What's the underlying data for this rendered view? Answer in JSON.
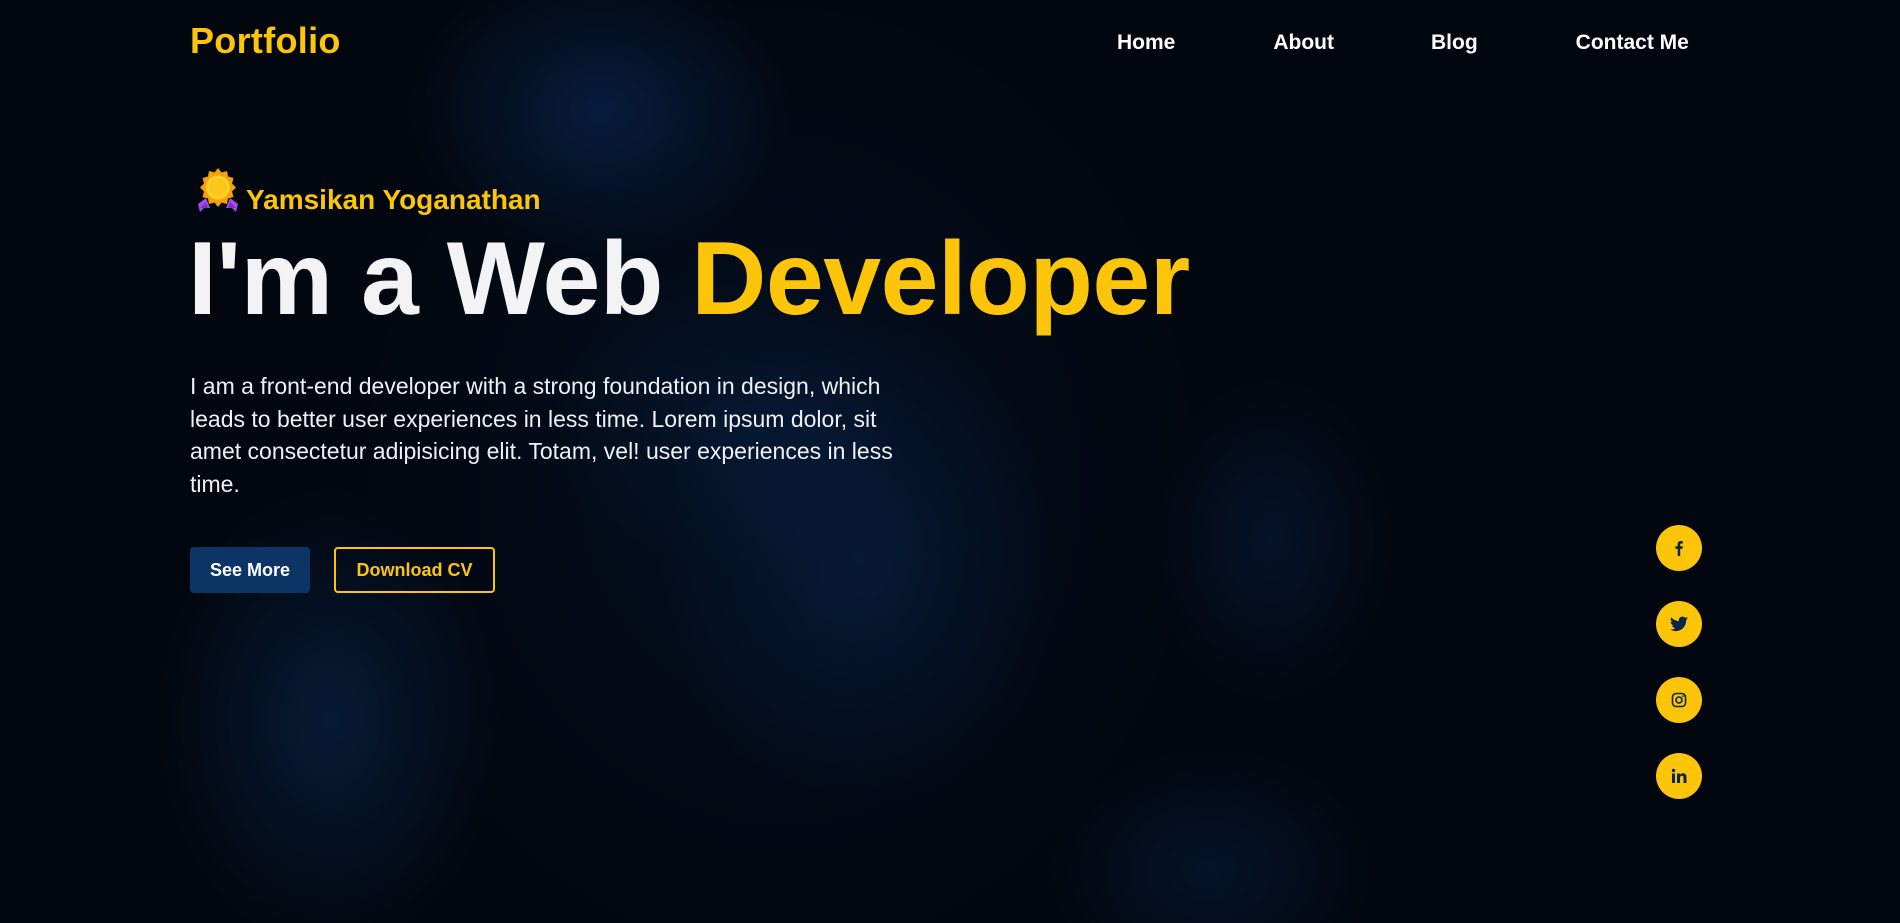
{
  "header": {
    "logo": "Portfolio",
    "nav": [
      "Home",
      "About",
      "Blog",
      "Contact Me"
    ]
  },
  "hero": {
    "badge_icon": "medal-badge-icon",
    "name": "Yamsikan Yoganathan",
    "headline_white": "I'm a Web ",
    "headline_yellow": "Developer",
    "description": "I am a front-end developer with a strong foundation in design, which leads to better user experiences in less time. Lorem ipsum dolor, sit amet consectetur adipisicing elit. Totam, vel! user experiences in less time.",
    "buttons": {
      "primary": "See More",
      "secondary": "Download CV"
    }
  },
  "social": [
    {
      "icon": "facebook-icon"
    },
    {
      "icon": "twitter-icon"
    },
    {
      "icon": "instagram-icon"
    },
    {
      "icon": "linkedin-icon"
    }
  ],
  "colors": {
    "accent": "#fdc50a",
    "background": "#02070f",
    "primary_button": "#0c3566",
    "text": "#f3f2f5"
  }
}
